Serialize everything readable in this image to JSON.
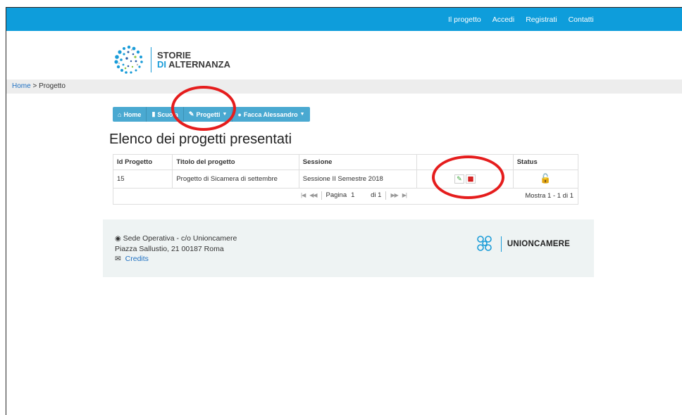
{
  "top_nav": {
    "items": [
      "Il progetto",
      "Accedi",
      "Registrati",
      "Contatti"
    ],
    "bg_color": "#0e9ddb"
  },
  "logo": {
    "line1": "STORIE",
    "line2_di": "DI",
    "line2_rest": "ALTERNANZA",
    "icon": "dots-circle-logo"
  },
  "breadcrumb": {
    "home": "Home",
    "separator": ">",
    "current": "Progetto"
  },
  "menu": {
    "items": [
      {
        "icon": "home-icon",
        "label": "Home"
      },
      {
        "icon": "book-icon",
        "label": "Scuola"
      },
      {
        "icon": "pencil-icon",
        "label": "Progetti"
      },
      {
        "icon": "user-icon",
        "label": "Facca Alessandro"
      }
    ],
    "color": "#4aa9d1"
  },
  "page_title": "Elenco dei progetti presentati",
  "table": {
    "headers": [
      "Id Progetto",
      "Titolo del progetto",
      "Sessione",
      "",
      "Status"
    ],
    "rows": [
      {
        "id": "15",
        "title": "Progetto di Sicamera di settembre",
        "session": "Sessione II Semestre 2018",
        "status_icon": "unlock-icon"
      }
    ],
    "pager": {
      "page_label": "Pagina",
      "page_value": "1",
      "of_label": "di 1",
      "records": "Mostra 1 - 1 di 1"
    }
  },
  "footer": {
    "address_line1": "Sede Operativa - c/o Unioncamere",
    "address_line2": "Piazza Sallustio, 21 00187 Roma",
    "credits": "Credits",
    "partner": "UNIONCAMERE"
  },
  "annotation_color": "#e51d1d"
}
